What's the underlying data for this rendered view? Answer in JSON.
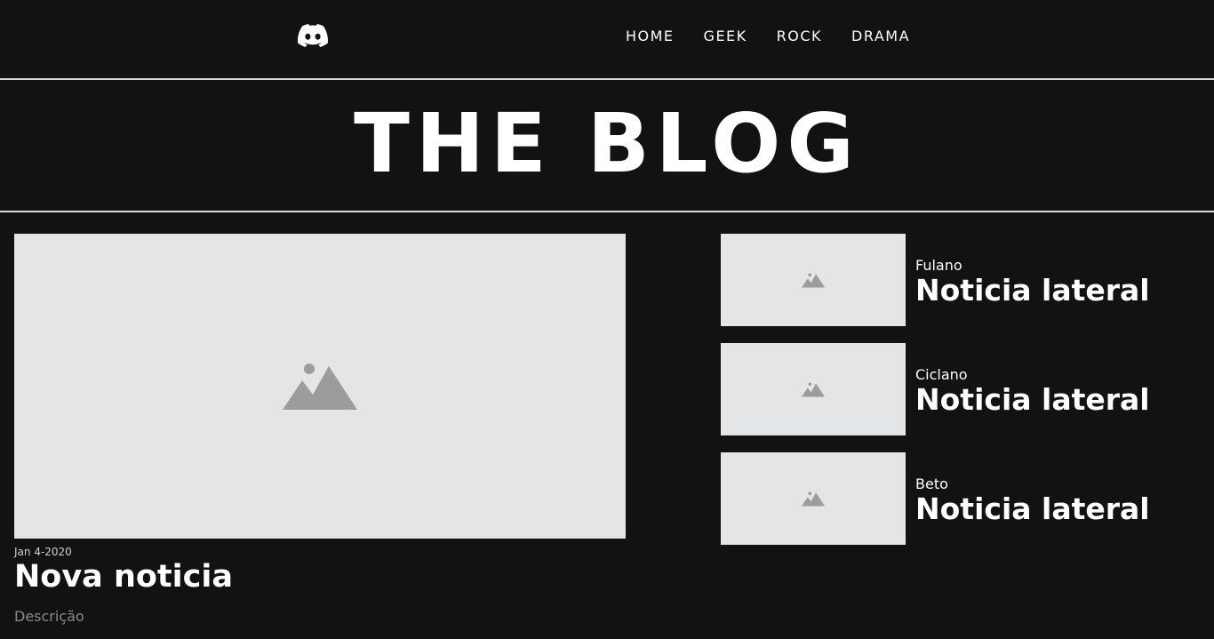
{
  "nav": {
    "logo_icon": "discord-icon",
    "links": [
      {
        "label": "HOME"
      },
      {
        "label": "GEEK"
      },
      {
        "label": "ROCK"
      },
      {
        "label": "DRAMA"
      }
    ]
  },
  "hero": {
    "title": "THE BLOG"
  },
  "main_post": {
    "image_icon": "image-placeholder-icon",
    "date": "Jan 4-2020",
    "title": "Nova noticia",
    "description": "Descrição"
  },
  "side_posts": [
    {
      "author": "Fulano",
      "title": "Noticia lateral",
      "image_icon": "image-placeholder-icon"
    },
    {
      "author": "Ciclano",
      "title": "Noticia lateral",
      "image_icon": "image-placeholder-icon"
    },
    {
      "author": "Beto",
      "title": "Noticia lateral",
      "image_icon": "image-placeholder-icon"
    }
  ],
  "colors": {
    "background": "#121212",
    "text": "#ffffff",
    "rule": "#d9d9d9",
    "placeholder_bg": "#e4e5e7",
    "placeholder_icon": "#9b9c9e",
    "description": "#8a8a8a"
  }
}
